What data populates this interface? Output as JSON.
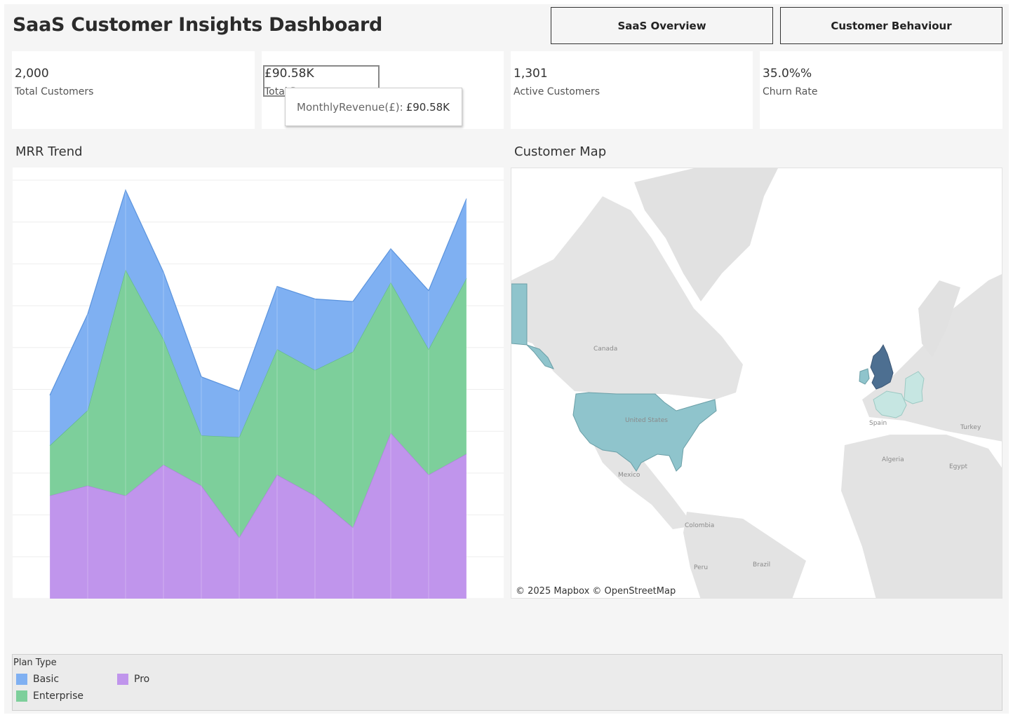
{
  "header": {
    "title": "SaaS Customer Insights Dashboard",
    "nav": [
      "SaaS Overview",
      "Customer Behaviour"
    ]
  },
  "kpis": [
    {
      "value": "2,000",
      "label": "Total Customers"
    },
    {
      "value": "£90.58K",
      "label": "Total Revenue"
    },
    {
      "value": "1,301",
      "label": "Active Customers"
    },
    {
      "value": "35.0%%",
      "label": "Churn Rate"
    }
  ],
  "tooltip": {
    "label": "MonthlyRevenue(£):",
    "value": "£90.58K"
  },
  "mrr": {
    "title": "MRR Trend"
  },
  "map": {
    "title": "Customer Map",
    "attribution": "© 2025 Mapbox  © OpenStreetMap",
    "labels": [
      "Canada",
      "United States",
      "Mexico",
      "Colombia",
      "Peru",
      "Brazil",
      "Spain",
      "Algeria",
      "Egypt",
      "Turkey"
    ]
  },
  "legend": {
    "title": "Plan Type",
    "items": [
      {
        "name": "Basic",
        "color": "#7fb0f2"
      },
      {
        "name": "Pro",
        "color": "#c095ec"
      },
      {
        "name": "Enterprise",
        "color": "#7dcf9b"
      }
    ]
  },
  "colors": {
    "basic": "#7fb0f2",
    "enterprise": "#7dcf9b",
    "pro": "#c095ec",
    "map_dark": "#4d6f91",
    "map_mid": "#8fc4cc",
    "map_light": "#c6e6e2"
  },
  "chart_data": {
    "type": "area",
    "stacked": true,
    "title": "MRR Trend",
    "xlabel": "",
    "ylabel": "",
    "grid": true,
    "legend": "bottom",
    "x": [
      1,
      2,
      3,
      4,
      5,
      6,
      7,
      8,
      9,
      10,
      11,
      12
    ],
    "ylim": [
      0,
      10
    ],
    "series": [
      {
        "name": "Pro",
        "values": [
          2.46,
          2.7,
          2.46,
          3.2,
          2.7,
          1.46,
          2.96,
          2.46,
          1.7,
          3.96,
          2.96,
          3.46
        ]
      },
      {
        "name": "Enterprise",
        "values": [
          1.2,
          1.8,
          5.4,
          3.0,
          1.2,
          2.4,
          3.0,
          3.0,
          4.2,
          3.6,
          3.0,
          4.2
        ]
      },
      {
        "name": "Basic",
        "values": [
          1.2,
          2.3,
          1.9,
          1.6,
          1.4,
          1.1,
          1.5,
          1.7,
          1.2,
          0.8,
          1.4,
          1.9
        ]
      }
    ]
  }
}
